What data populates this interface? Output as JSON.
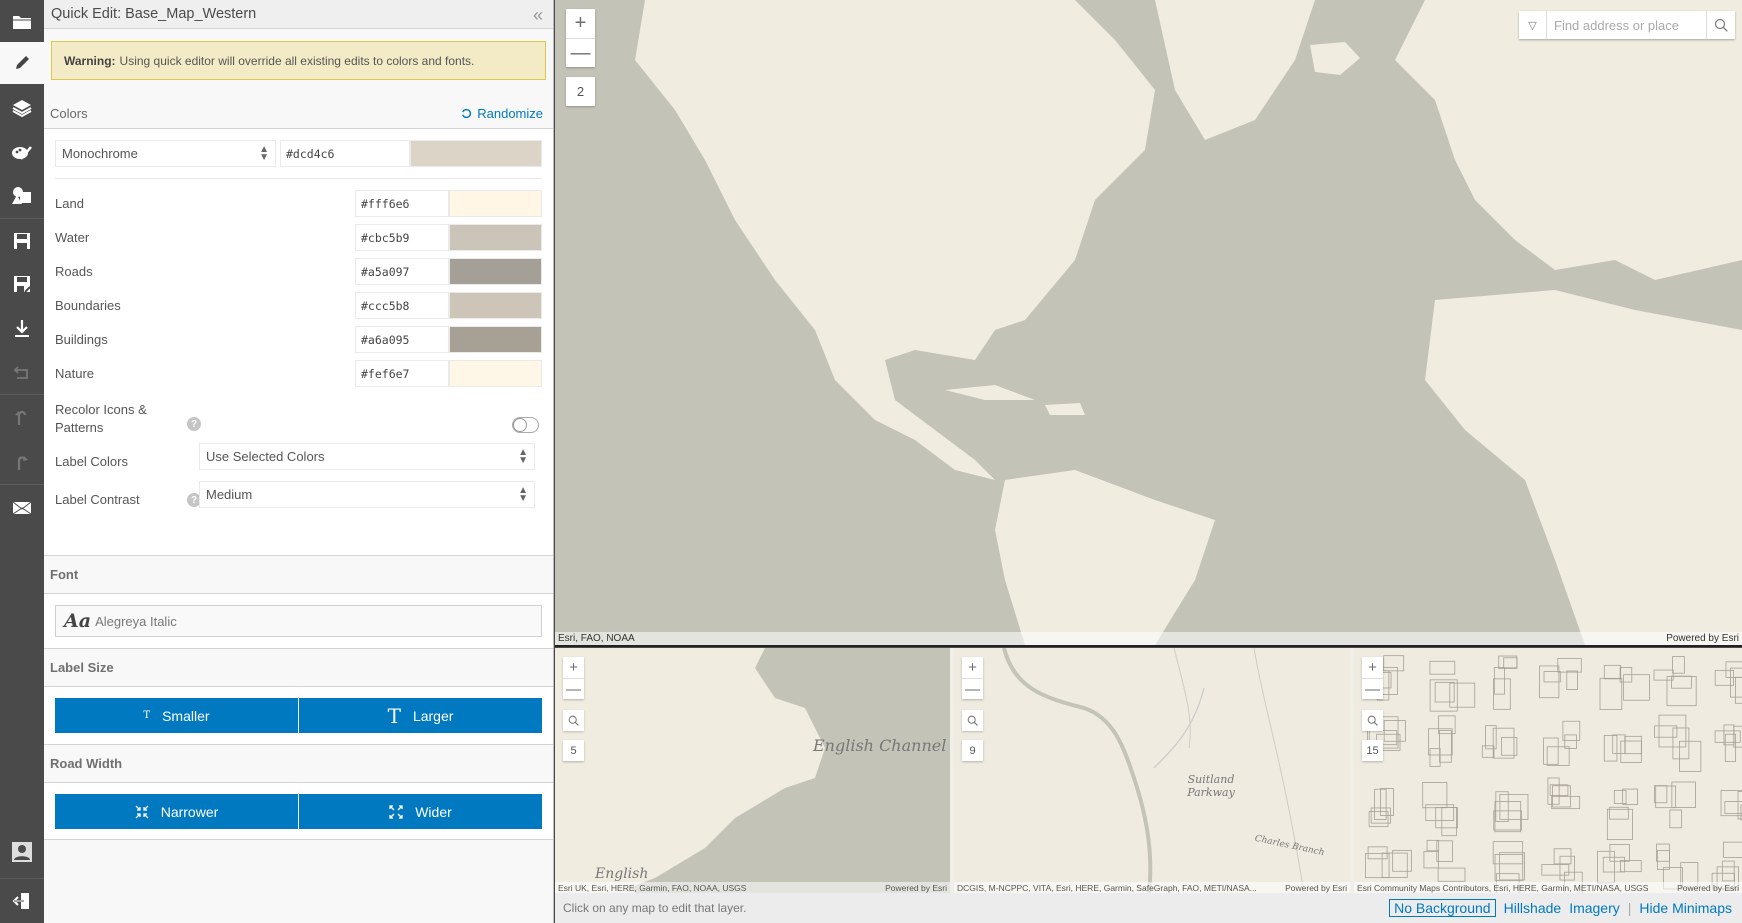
{
  "sidebar": {
    "items": [
      {
        "name": "open-icon",
        "label": "Open"
      },
      {
        "name": "quick-edit-icon",
        "label": "Quick Edit",
        "active": true
      },
      {
        "name": "layers-icon",
        "label": "Layers"
      },
      {
        "name": "style-icon",
        "label": "Style"
      },
      {
        "name": "shapes-icon",
        "label": "Symbols"
      },
      {
        "name": "save-icon",
        "label": "Save"
      },
      {
        "name": "save-as-icon",
        "label": "Save As"
      },
      {
        "name": "download-icon",
        "label": "Download"
      },
      {
        "name": "revert-icon",
        "label": "Revert"
      },
      {
        "name": "undo-icon",
        "label": "Undo"
      },
      {
        "name": "redo-icon",
        "label": "Redo"
      },
      {
        "name": "share-icon",
        "label": "Share"
      },
      {
        "name": "user-icon",
        "label": "Account"
      },
      {
        "name": "sign-out-icon",
        "label": "Sign Out"
      }
    ]
  },
  "panel": {
    "title": "Quick Edit: Base_Map_Western",
    "warning_bold": "Warning:",
    "warning_text": "Using quick editor will override all existing edits to colors and fonts.",
    "colors_section": {
      "heading": "Colors",
      "randomize_label": "Randomize",
      "scheme_select": "Monochrome",
      "scheme_hex": "#dcd4c6",
      "scheme_color": "#dcd4c6",
      "rows": [
        {
          "label": "Land",
          "hex": "#fff6e6"
        },
        {
          "label": "Water",
          "hex": "#cbc5b9"
        },
        {
          "label": "Roads",
          "hex": "#a5a097"
        },
        {
          "label": "Boundaries",
          "hex": "#ccc5b8"
        },
        {
          "label": "Buildings",
          "hex": "#a6a095"
        },
        {
          "label": "Nature",
          "hex": "#fef6e7"
        }
      ],
      "recolor_label": "Recolor Icons & Patterns",
      "recolor_enabled": false,
      "label_colors_label": "Label Colors",
      "label_colors_value": "Use Selected Colors",
      "label_contrast_label": "Label Contrast",
      "label_contrast_value": "Medium"
    },
    "font_section": {
      "heading": "Font",
      "sample": "Aa",
      "font_name": "Alegreya Italic"
    },
    "label_size_section": {
      "heading": "Label Size",
      "smaller_label": "Smaller",
      "larger_label": "Larger"
    },
    "road_width_section": {
      "heading": "Road Width",
      "narrower_label": "Narrower",
      "wider_label": "Wider"
    }
  },
  "main_map": {
    "zoom_level": "2",
    "search_placeholder": "Find address or place",
    "attribution": "Esri, FAO, NOAA",
    "powered_by": "Powered by Esri"
  },
  "minimaps": [
    {
      "zoom_level": "5",
      "attribution": "Esri UK, Esri, HERE, Garmin, FAO, NOAA, USGS",
      "powered_by": "Powered by Esri",
      "labels": [
        "English Channel",
        "English"
      ]
    },
    {
      "zoom_level": "9",
      "attribution": "DCGIS, M-NCPPC, VITA, Esri, HERE, Garmin, SafeGraph, FAO, METI/NASA...",
      "powered_by": "Powered by Esri",
      "labels": [
        "Suitland Parkway",
        "Charles Branch"
      ]
    },
    {
      "zoom_level": "15",
      "attribution": "Esri Community Maps Contributors, Esri, HERE, Garmin, METI/NASA, USGS",
      "powered_by": "Powered by Esri",
      "labels": []
    }
  ],
  "bottom_bar": {
    "message": "Click on any map to edit that layer.",
    "background_options": [
      "No Background",
      "Hillshade",
      "Imagery"
    ],
    "selected_background": "No Background",
    "hide_minimaps_label": "Hide Minimaps"
  }
}
